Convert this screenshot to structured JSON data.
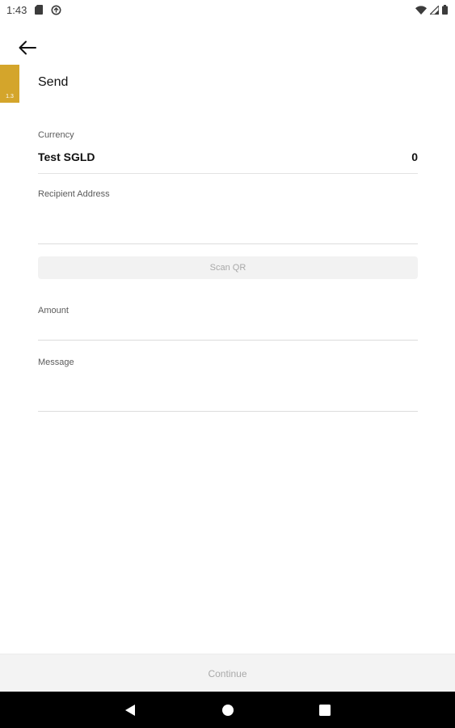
{
  "status_bar": {
    "time": "1:43",
    "icons_left": [
      "sd-card-icon",
      "sync-icon"
    ],
    "icons_right": [
      "wifi-icon",
      "signal-icon",
      "battery-icon"
    ]
  },
  "header": {
    "back_icon": "arrow-left-icon",
    "title": "Send",
    "side_tag_label": "1.3"
  },
  "form": {
    "currency": {
      "label": "Currency",
      "name": "Test SGLD",
      "balance": "0"
    },
    "recipient": {
      "label": "Recipient Address",
      "value": ""
    },
    "scan_button_label": "Scan QR",
    "amount": {
      "label": "Amount",
      "value": ""
    },
    "message": {
      "label": "Message",
      "value": ""
    }
  },
  "footer": {
    "continue_label": "Continue"
  },
  "nav_bar": {
    "icons": [
      "back-triangle-icon",
      "home-circle-icon",
      "recents-square-icon"
    ]
  },
  "colors": {
    "accent": "#d4a52b",
    "disabled_text": "#a9a9a9",
    "divider": "#dcdcdc",
    "nav_background": "#000000"
  }
}
